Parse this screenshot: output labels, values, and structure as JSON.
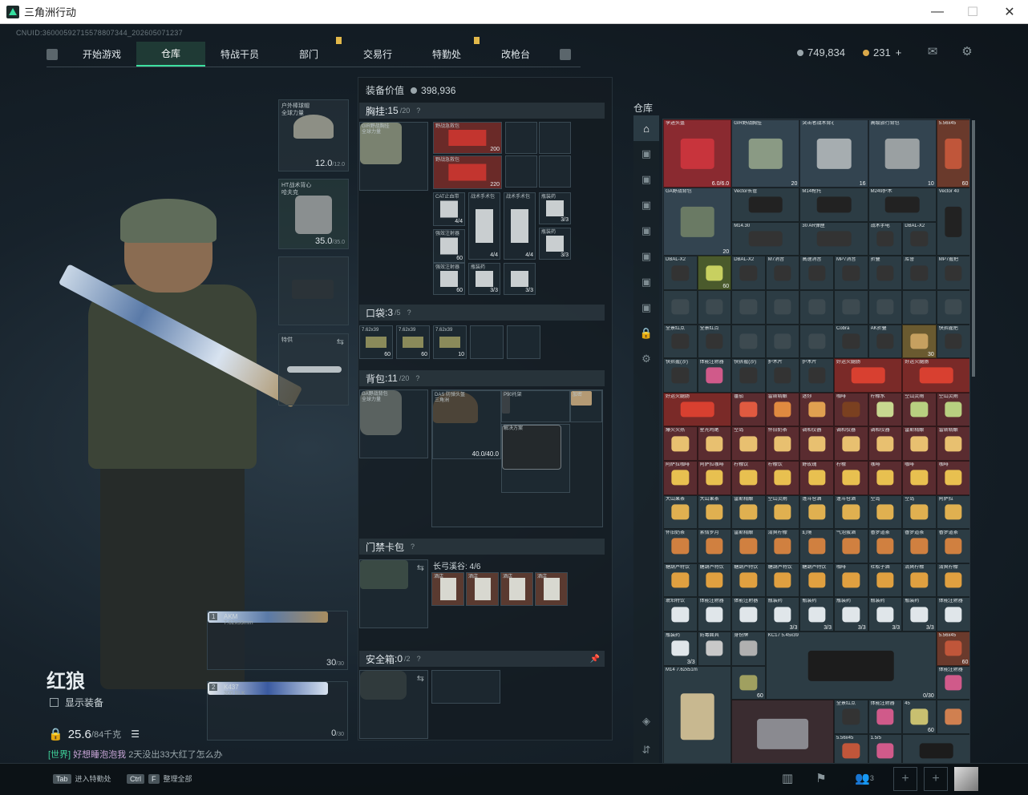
{
  "window": {
    "title": "三角洲行动"
  },
  "app": {
    "uid": "CNUID:36000592715578807344_202605071237"
  },
  "nav": {
    "tabs": [
      "开始游戏",
      "仓库",
      "特战干员",
      "部门",
      "交易行",
      "特勤处",
      "改枪台"
    ],
    "active": "仓库"
  },
  "currency": {
    "coins": "749,834",
    "tokens": "231"
  },
  "character": {
    "name": "红狼",
    "show_equipment": "显示装备",
    "weight": "25.6",
    "weight_max": "/84千克",
    "chat_tag": "[世界]",
    "chat_user": "好想睡泡泡我",
    "chat_text": "2天没出33大红了怎么办"
  },
  "gear": {
    "helmet": {
      "label": "户外棒球帽\n全球力量",
      "value": "12.0",
      "max": "/12.0"
    },
    "armor": {
      "label": "HT战术背心\n哈夫克",
      "value": "35.0",
      "max": "/35.0"
    },
    "melee": {
      "label": "特供"
    },
    "weapon1": {
      "slot": "1",
      "name": "AKM",
      "ammo": "7.62x39mm",
      "count": "30",
      "max": "/30"
    },
    "weapon2": {
      "slot": "2",
      "name": "K437",
      "ammo": "300 BLK",
      "count": "0",
      "max": "/30"
    }
  },
  "equipment": {
    "value_label": "装备价值",
    "value": "398,936",
    "chest": {
      "title": "胸挂",
      "count": "15",
      "max": "/20",
      "item": "GIR野战胸挂\n全球力量"
    },
    "pocket": {
      "title": "口袋",
      "count": "3",
      "max": "/5"
    },
    "backpack": {
      "title": "背包",
      "count": "11",
      "max": "/20",
      "item": "GA野战背包\n全球力量",
      "helmet": "DAS 防弹头盔\n三角洲",
      "helmet_val": "40.0/40.0",
      "tool": "P90托架",
      "case": "解决方案",
      "small": "加密"
    },
    "keycard": {
      "title": "门禁卡包",
      "desc": "长弓溪谷: 4/6"
    },
    "safe": {
      "title": "安全箱",
      "count": "0",
      "max": "/2"
    }
  },
  "chest_items": [
    {
      "t": "野战急救包",
      "n": "200"
    },
    {
      "t": "野战急救包",
      "n": "220"
    },
    {
      "t": "CAT止血带",
      "n": "4/4"
    },
    {
      "t": "战术手术包",
      "n": "4/4"
    },
    {
      "t": "战术手术包",
      "n": "4/4"
    },
    {
      "t": "瓶装药",
      "n": "3/3"
    },
    {
      "t": "强效注射器",
      "n": "60"
    },
    {
      "t": "瓶装药",
      "n": "3/3"
    },
    {
      "t": "强效注射器",
      "n": "60"
    },
    {
      "t": "瓶装药",
      "n": "3/3"
    },
    {
      "t": "",
      "n": "3/3"
    }
  ],
  "pocket_items": [
    {
      "t": "7.62x39",
      "n": "60"
    },
    {
      "t": "7.62x39",
      "n": "60"
    },
    {
      "t": "7.62x39",
      "n": "10"
    }
  ],
  "keycards": [
    "酒店",
    "酒店",
    "酒店",
    "酒店"
  ],
  "storage": {
    "title": "仓库",
    "items": [
      {
        "t": "李进头盔",
        "n": "6.0/6.0",
        "c": "#8a2a30"
      },
      {
        "t": "GIR野战胸挂",
        "n": "20",
        "c": "#334450"
      },
      {
        "t": "突击者战术背心",
        "n": "16",
        "c": "#334450"
      },
      {
        "t": "高级旅行背包",
        "n": "10",
        "c": "#334450"
      },
      {
        "t": "5.56x45",
        "n": "60",
        "c": "#6a3a2c"
      },
      {
        "t": "GA野战背包",
        "n": "20",
        "c": "#334450"
      },
      {
        "t": "Vector长管",
        "n": "",
        "c": "#2c3c44"
      },
      {
        "t": "M14枪托",
        "n": "",
        "c": "#2c3c44"
      },
      {
        "t": "M249护木",
        "n": "",
        "c": "#2c3c44"
      },
      {
        "t": "Vector 40",
        "n": "",
        "c": "#2c3c44"
      },
      {
        "t": "M14.30",
        "n": "",
        "c": "#2c3c44"
      },
      {
        "t": "30 AR弹匣",
        "n": "",
        "c": "#2c3c44"
      },
      {
        "t": "战术手电",
        "n": "",
        "c": "#2c3c44"
      },
      {
        "t": "DBAL-X2",
        "n": "",
        "c": "#2c3c44"
      },
      {
        "t": "DBAL-X2",
        "n": "",
        "c": "#2c3c44"
      },
      {
        "t": "",
        "n": "60",
        "c": "#4a5a2c"
      },
      {
        "t": "DBAL-X2",
        "n": "",
        "c": "#2c3c44"
      },
      {
        "t": "M7消音",
        "n": "",
        "c": "#2c3c44"
      },
      {
        "t": "高速消音",
        "n": "",
        "c": "#2c3c44"
      },
      {
        "t": "MP7消音",
        "n": "",
        "c": "#2c3c44"
      },
      {
        "t": "折叠",
        "n": "",
        "c": "#2c3c44"
      },
      {
        "t": "库鲁",
        "n": "",
        "c": "#2c3c44"
      },
      {
        "t": "MP7握把",
        "n": "",
        "c": "#2c3c44"
      },
      {
        "t": "全景红点",
        "n": "",
        "c": "#2c3c44"
      },
      {
        "t": "全景红点",
        "n": "",
        "c": "#2c3c44"
      },
      {
        "t": "Cobra",
        "n": "",
        "c": "#2c3c44"
      },
      {
        "t": "AK折叠",
        "n": "",
        "c": "#2c3c44"
      },
      {
        "t": "",
        "n": "30",
        "c": "#6a5a30"
      },
      {
        "t": "快拆握把",
        "n": "",
        "c": "#2c3c44"
      },
      {
        "t": "快拆握(沙)",
        "n": "",
        "c": "#2c3c44"
      },
      {
        "t": "体能注射器",
        "n": "",
        "c": "#2c3c44"
      },
      {
        "t": "快拆握(沙)",
        "n": "",
        "c": "#2c3c44"
      },
      {
        "t": "护木片",
        "n": "",
        "c": "#2c3c44"
      },
      {
        "t": "护木片",
        "n": "",
        "c": "#2c3c44"
      },
      {
        "t": "好运火腿肠",
        "n": "",
        "c": "#7a2a28"
      },
      {
        "t": "好运火腿肠",
        "n": "",
        "c": "#7a2a28"
      },
      {
        "t": "好运火腿肠",
        "n": "",
        "c": "#7a2a28"
      },
      {
        "t": "番茄",
        "n": "",
        "c": "#5a2c30"
      },
      {
        "t": "雷斯精酿",
        "n": "",
        "c": "#5a2c30"
      },
      {
        "t": "迷你",
        "n": "",
        "c": "#5a2c30"
      },
      {
        "t": "咖啡",
        "n": "",
        "c": "#5a2c30"
      },
      {
        "t": "柠檬水",
        "n": "",
        "c": "#5a2c30"
      },
      {
        "t": "空山灵雨",
        "n": "",
        "c": "#5a2c30"
      },
      {
        "t": "空山灵雨",
        "n": "",
        "c": "#5a2c30"
      }
    ],
    "drinks_a": [
      "爆火火热",
      "星光鸡尾",
      "空岛",
      "怀旧奶茶",
      "调和仪器",
      "调和仪器",
      "调和仪器",
      "雷斯精酿",
      "雷斯精酿"
    ],
    "drinks_b": [
      "阿萨拉咖啡",
      "阿萨拉咖啡",
      "柠檬饮",
      "柠檬饮",
      "野玫瑰",
      "柠檬",
      "咖啡",
      "咖啡",
      "咖啡"
    ],
    "drinks_c": [
      "大山果茶",
      "大山果茶",
      "雷斯精酿",
      "空山灵雨",
      "蓬斗仓酒",
      "蓬斗仓酒",
      "空岛",
      "空岛",
      "阿萨拉"
    ],
    "drinks_d": [
      "怀旧奶茶",
      "素情岁月",
      "雷斯精酿",
      "清爽柠檬",
      "幻境",
      "气泡蛋酒",
      "香梦道茶",
      "香梦道茶",
      "香梦道茶"
    ],
    "drinks_e": [
      "糖葫芦特饮",
      "糖葫芦特饮",
      "糖葫芦特饮",
      "糖葫芦特饮",
      "糖葫芦特饮",
      "咖啡",
      "杜松子酒",
      "清爽柠檬",
      "清爽柠檬"
    ],
    "drinks_f": [
      "琥珀特饮",
      "体能注射器",
      "体能注射器",
      "瓶装药",
      "瓶装药",
      "瓶装药",
      "瓶装药",
      "瓶装药",
      "体能注射器"
    ],
    "misc": [
      "瓶装药",
      "防毒面具",
      "身份牌",
      "KC17",
      "5.45x39",
      "M14",
      "7.62x51mm",
      "全景红点",
      "体能注射器",
      "45",
      "体能注射器",
      "5.56x45",
      "1.5/5"
    ],
    "misc_n": [
      "3/3",
      "3/3",
      "0/30",
      "60",
      "3/3",
      "60"
    ]
  },
  "bottom": {
    "k1": "Tab",
    "k1_lbl": "进入特勤处",
    "k2": "Ctrl",
    "k2b": "F",
    "k2_lbl": "整理全部",
    "friends": "3"
  }
}
